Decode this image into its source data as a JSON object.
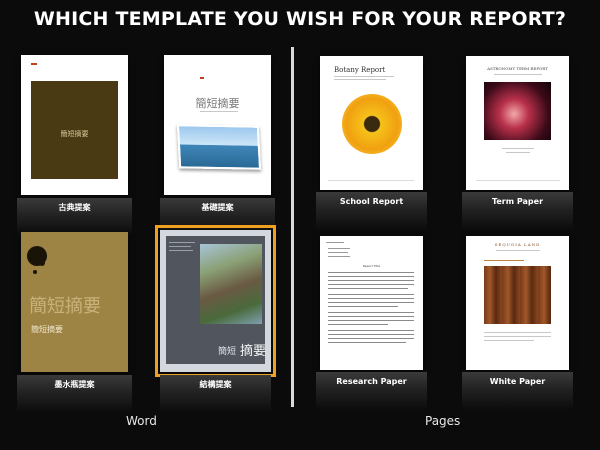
{
  "headline": "WHICH TEMPLATE YOU WISH FOR YOUR REPORT?",
  "sections": {
    "word": "Word",
    "pages": "Pages"
  },
  "word_templates": [
    {
      "label": "古典提案",
      "cover_title": "簡短摘要"
    },
    {
      "label": "基礎提案",
      "cover_title": "簡短摘要"
    },
    {
      "label": "墨水瓶提案",
      "cover_title": "簡短摘要",
      "cover_subtitle": "簡短摘要"
    },
    {
      "label": "結構提案",
      "cover_title": "簡短",
      "cover_subtitle": "摘要"
    }
  ],
  "pages_templates": [
    {
      "label": "School Report",
      "cover_title": "Botany Report"
    },
    {
      "label": "Term Paper",
      "cover_title": "ASTRONOMY TERM REPORT"
    },
    {
      "label": "Research Paper",
      "cover_title": "Report Title"
    },
    {
      "label": "White Paper",
      "cover_title": "SEQUOIA LAND"
    }
  ],
  "colors": {
    "accent": "#f0a020",
    "plate": "#2a2a2a",
    "background": "#0b0b0b"
  }
}
